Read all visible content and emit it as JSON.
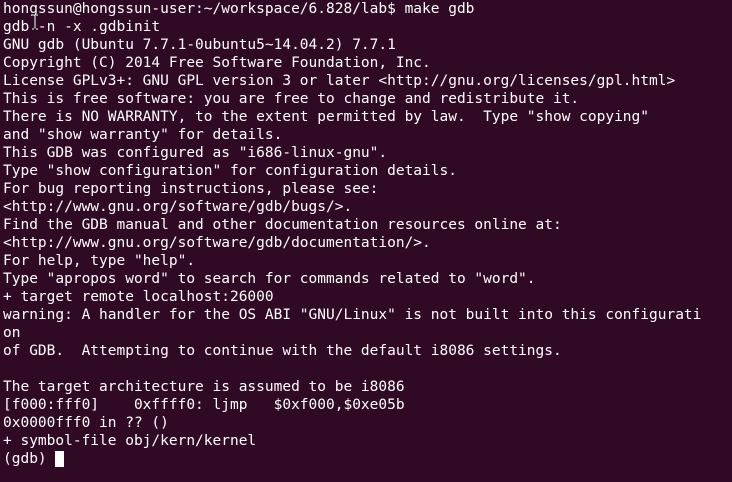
{
  "terminal": {
    "lines": [
      "hongssun@hongssun-user:~/workspace/6.828/lab$ make gdb",
      "gdb -n -x .gdbinit",
      "GNU gdb (Ubuntu 7.7.1-0ubuntu5~14.04.2) 7.7.1",
      "Copyright (C) 2014 Free Software Foundation, Inc.",
      "License GPLv3+: GNU GPL version 3 or later <http://gnu.org/licenses/gpl.html>",
      "This is free software: you are free to change and redistribute it.",
      "There is NO WARRANTY, to the extent permitted by law.  Type \"show copying\"",
      "and \"show warranty\" for details.",
      "This GDB was configured as \"i686-linux-gnu\".",
      "Type \"show configuration\" for configuration details.",
      "For bug reporting instructions, please see:",
      "<http://www.gnu.org/software/gdb/bugs/>.",
      "Find the GDB manual and other documentation resources online at:",
      "<http://www.gnu.org/software/gdb/documentation/>.",
      "For help, type \"help\".",
      "Type \"apropos word\" to search for commands related to \"word\".",
      "+ target remote localhost:26000",
      "warning: A handler for the OS ABI \"GNU/Linux\" is not built into this configurati",
      "on",
      "of GDB.  Attempting to continue with the default i8086 settings.",
      "",
      "The target architecture is assumed to be i8086",
      "[f000:fff0]    0xffff0: ljmp   $0xf000,$0xe05b",
      "0x0000fff0 in ?? ()",
      "+ symbol-file obj/kern/kernel"
    ],
    "prompt": "(gdb) ",
    "colors": {
      "background": "#300a24",
      "foreground": "#ffffff"
    }
  }
}
